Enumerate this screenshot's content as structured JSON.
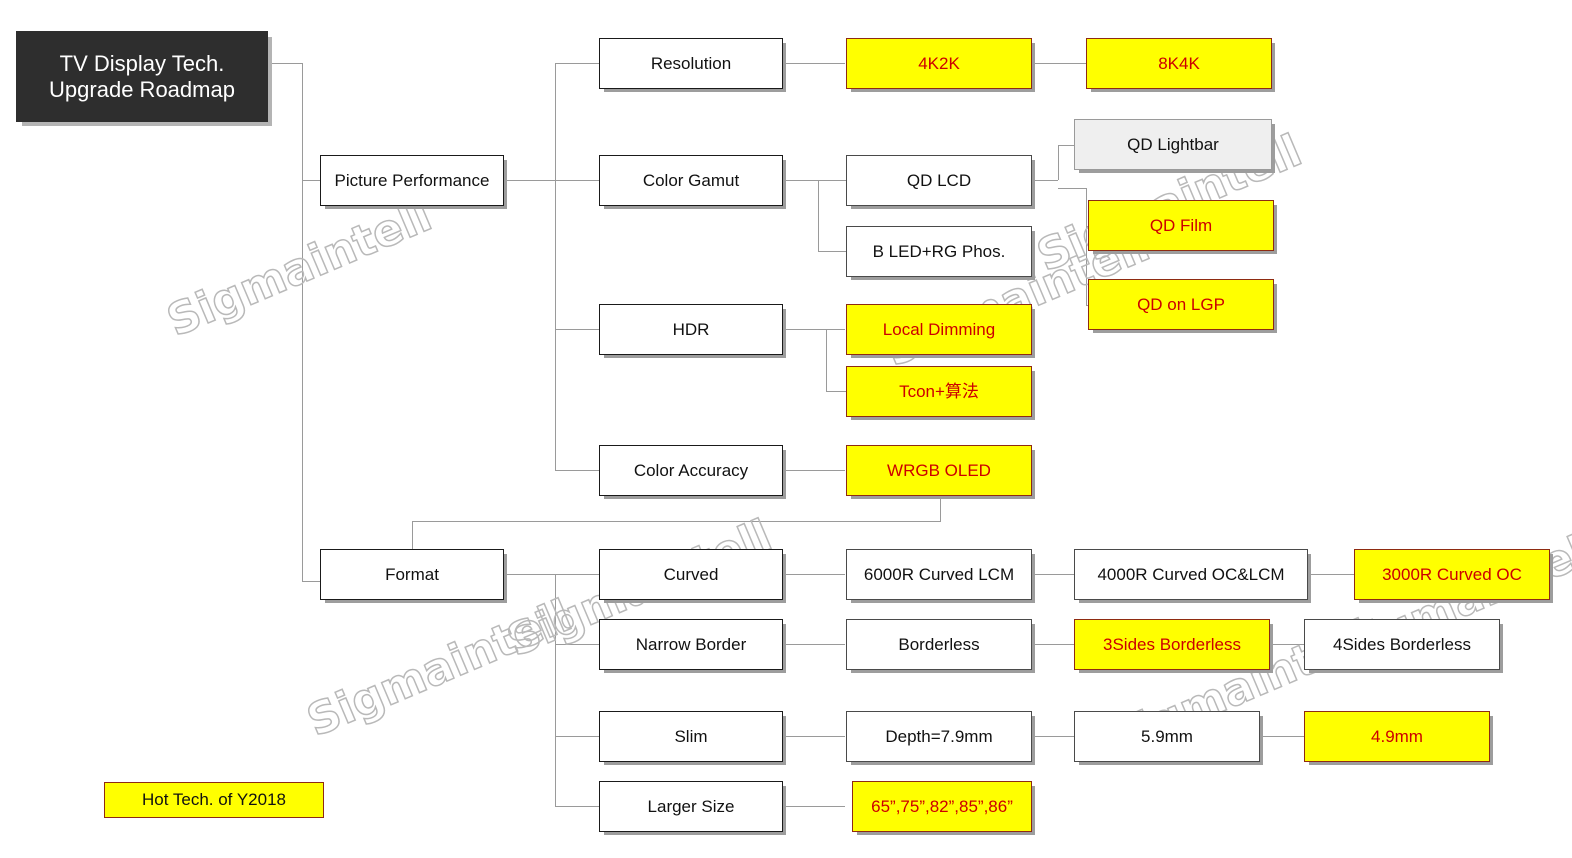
{
  "diagram": {
    "title_box": {
      "line1": "TV Display Tech.",
      "line2": "Upgrade Roadmap"
    },
    "legend": {
      "label": "Hot Tech. of Y2018"
    },
    "watermark": {
      "text": "Sigmaintell"
    },
    "colors": {
      "highlight_fill": "#ffff00",
      "highlight_text": "#cc0000",
      "highlight_border": "#8e2b12",
      "title_fill": "#2e2e2e",
      "title_text": "#ffffff",
      "gray_fill": "#efefef",
      "line": "#9a9a9a",
      "node_text": "#111111"
    },
    "branches": {
      "picture_performance": "Picture Performance",
      "format": "Format"
    },
    "nodes": {
      "resolution": "Resolution",
      "res_4k2k": "4K2K",
      "res_8k4k": "8K4K",
      "color_gamut": "Color Gamut",
      "qd_lcd": "QD LCD",
      "b_led_rg_phos": "B LED+RG Phos.",
      "qd_lightbar": "QD Lightbar",
      "qd_film": "QD Film",
      "qd_on_lgp": "QD on LGP",
      "hdr": "HDR",
      "local_dimming": "Local Dimming",
      "tcon_algo": "Tcon+算法",
      "color_accuracy": "Color Accuracy",
      "wrgb_oled": "WRGB OLED",
      "curved": "Curved",
      "curved_6000r": "6000R Curved LCM",
      "curved_4000r": "4000R Curved OC&LCM",
      "curved_3000r": "3000R Curved OC",
      "narrow_border": "Narrow Border",
      "borderless": "Borderless",
      "borderless_3sides": "3Sides Borderless",
      "borderless_4sides": "4Sides Borderless",
      "slim": "Slim",
      "depth_79": "Depth=7.9mm",
      "depth_59": "5.9mm",
      "depth_49": "4.9mm",
      "larger_size": "Larger Size",
      "sizes_list": "65”,75”,82”,85”,86”"
    }
  }
}
